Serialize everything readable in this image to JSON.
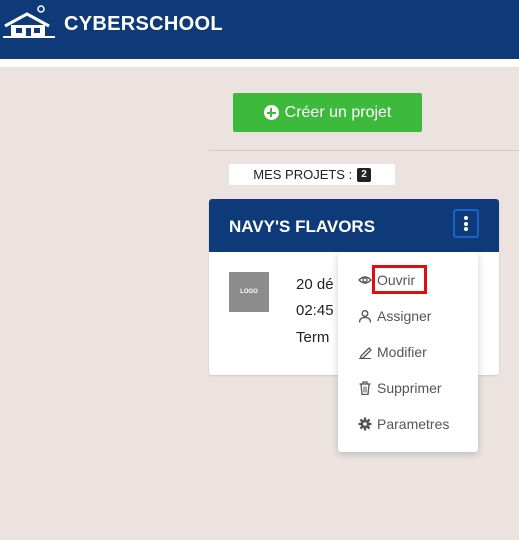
{
  "header": {
    "brand": "CYBERSCHOOL",
    "logo_icon": "school-building-icon"
  },
  "actions": {
    "create_label": "Créer un projet",
    "create_icon": "plus-circle-icon"
  },
  "projects_section": {
    "label": "MES PROJETS :",
    "count": "2"
  },
  "project": {
    "title": "NAVY'S FLAVORS",
    "logo_text": "LOGO",
    "date_line": "20 dé",
    "time_line": "02:45",
    "status_line": "Term"
  },
  "menu": {
    "items": [
      {
        "label": "Ouvrir",
        "icon": "eye-icon"
      },
      {
        "label": "Assigner",
        "icon": "user-icon"
      },
      {
        "label": "Modifier",
        "icon": "pencil-icon"
      },
      {
        "label": "Supprimer",
        "icon": "trash-icon"
      },
      {
        "label": "Parametres",
        "icon": "gear-icon"
      }
    ]
  },
  "colors": {
    "primary": "#0e3a7a",
    "success": "#3dba3c",
    "highlight": "#e10d12",
    "background": "#ece3e0"
  }
}
